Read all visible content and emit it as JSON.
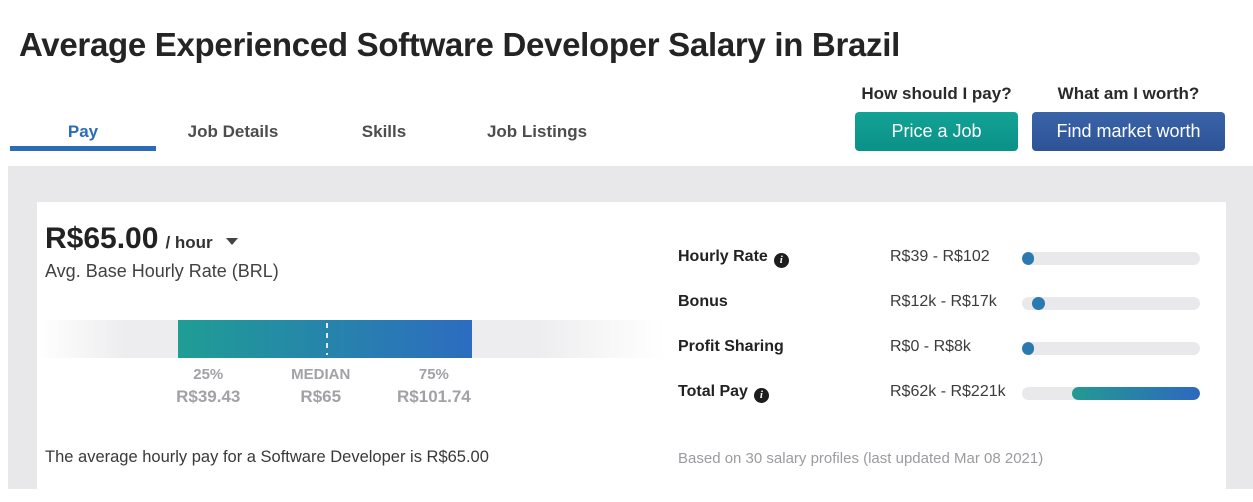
{
  "title": "Average Experienced Software Developer Salary in Brazil",
  "tabs": [
    {
      "label": "Pay",
      "active": true
    },
    {
      "label": "Job Details",
      "active": false
    },
    {
      "label": "Skills",
      "active": false
    },
    {
      "label": "Job Listings",
      "active": false
    }
  ],
  "cta": {
    "pay_question": "How should I pay?",
    "pay_button": "Price a Job",
    "worth_question": "What am I worth?",
    "worth_button": "Find market worth"
  },
  "salary_card": {
    "amount": "R$65.00",
    "unit": "/ hour",
    "subtitle": "Avg. Base Hourly Rate (BRL)",
    "range_bar": {
      "fill": {
        "kind": "gradient",
        "left_pct": 22.6,
        "width_pct": 47.0
      },
      "median_pct": 46.2,
      "percentiles": [
        {
          "label": "25%",
          "value": "R$39.43",
          "center_pct": 27.4
        },
        {
          "label": "MEDIAN",
          "value": "R$65",
          "center_pct": 45.4
        },
        {
          "label": "75%",
          "value": "R$101.74",
          "center_pct": 63.5
        }
      ]
    },
    "summary": "The average hourly pay for a Software Developer is R$65.00"
  },
  "pay_breakdown": {
    "rows": [
      {
        "label": "Hourly Rate",
        "has_info": true,
        "range": "R$39 - R$102",
        "fill": {
          "kind": "dot",
          "left_pct": 0,
          "width_pct": 6.5
        }
      },
      {
        "label": "Bonus",
        "has_info": false,
        "range": "R$12k - R$17k",
        "fill": {
          "kind": "dot",
          "left_pct": 5.5,
          "width_pct": 7.5
        }
      },
      {
        "label": "Profit Sharing",
        "has_info": false,
        "range": "R$0 - R$8k",
        "fill": {
          "kind": "dot",
          "left_pct": 0,
          "width_pct": 7.0
        }
      },
      {
        "label": "Total Pay",
        "has_info": true,
        "range": "R$62k - R$221k",
        "fill": {
          "kind": "gradient",
          "left_pct": 28,
          "width_pct": 72
        }
      }
    ],
    "footnote": "Based on 30 salary profiles (last updated Mar 08 2021)"
  },
  "colors": {
    "accent_blue": "#2a6cb5",
    "teal_button": "#0f9c90",
    "blue_button": "#34599e",
    "bar_teal": "#1f9d95",
    "bar_blue": "#2d6cc0",
    "dot_blue": "#2a79b0",
    "band_gray": "#e8e8ea",
    "muted_text": "#a1a1a7"
  }
}
